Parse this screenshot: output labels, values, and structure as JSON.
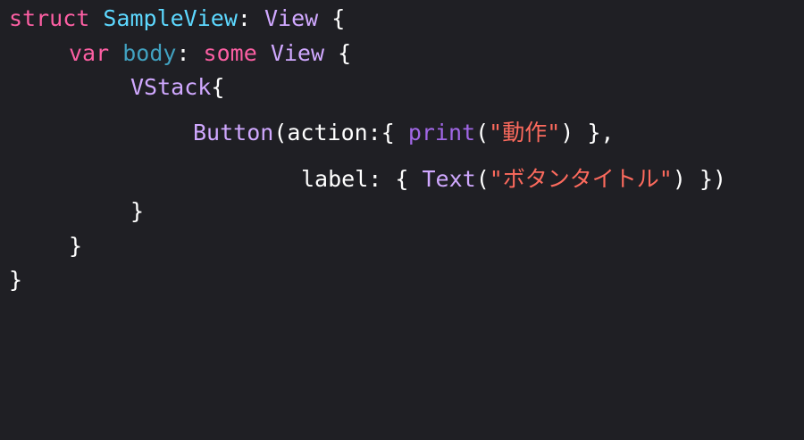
{
  "code": {
    "lines": [
      {
        "tokens": [
          {
            "text": "struct",
            "kind": "keyword"
          },
          {
            "text": " ",
            "kind": "plain"
          },
          {
            "text": "SampleView",
            "kind": "type-declaration"
          },
          {
            "text": ": ",
            "kind": "plain"
          },
          {
            "text": "View",
            "kind": "type"
          },
          {
            "text": " {",
            "kind": "plain"
          }
        ]
      },
      {
        "tokens": [
          {
            "text": "var",
            "kind": "keyword"
          },
          {
            "text": " ",
            "kind": "plain"
          },
          {
            "text": "body",
            "kind": "property"
          },
          {
            "text": ": ",
            "kind": "plain"
          },
          {
            "text": "some",
            "kind": "keyword"
          },
          {
            "text": " ",
            "kind": "plain"
          },
          {
            "text": "View",
            "kind": "type"
          },
          {
            "text": " {",
            "kind": "plain"
          }
        ]
      },
      {
        "tokens": [
          {
            "text": "VStack",
            "kind": "type"
          },
          {
            "text": "{",
            "kind": "plain"
          }
        ]
      },
      {
        "tokens": [
          {
            "text": "Button",
            "kind": "type"
          },
          {
            "text": "(action:{ ",
            "kind": "plain"
          },
          {
            "text": "print",
            "kind": "function"
          },
          {
            "text": "(",
            "kind": "plain"
          },
          {
            "text": "\"動作\"",
            "kind": "string"
          },
          {
            "text": ") },",
            "kind": "plain"
          }
        ]
      },
      {
        "tokens": [
          {
            "text": "label: { ",
            "kind": "plain"
          },
          {
            "text": "Text",
            "kind": "type"
          },
          {
            "text": "(",
            "kind": "plain"
          },
          {
            "text": "\"ボタンタイトル\"",
            "kind": "string"
          },
          {
            "text": ") })",
            "kind": "plain"
          }
        ]
      },
      {
        "tokens": [
          {
            "text": "}",
            "kind": "plain"
          }
        ]
      },
      {
        "tokens": [
          {
            "text": "}",
            "kind": "plain"
          }
        ]
      },
      {
        "tokens": [
          {
            "text": "}",
            "kind": "plain"
          }
        ]
      }
    ]
  },
  "colors": {
    "background": "#1f1f24",
    "keyword": "#fc5fa3",
    "type_declaration": "#5dd8ff",
    "type": "#d0a8ff",
    "property": "#41a1c0",
    "function": "#a167e6",
    "plain": "#ffffff",
    "string": "#fc6a5d"
  }
}
